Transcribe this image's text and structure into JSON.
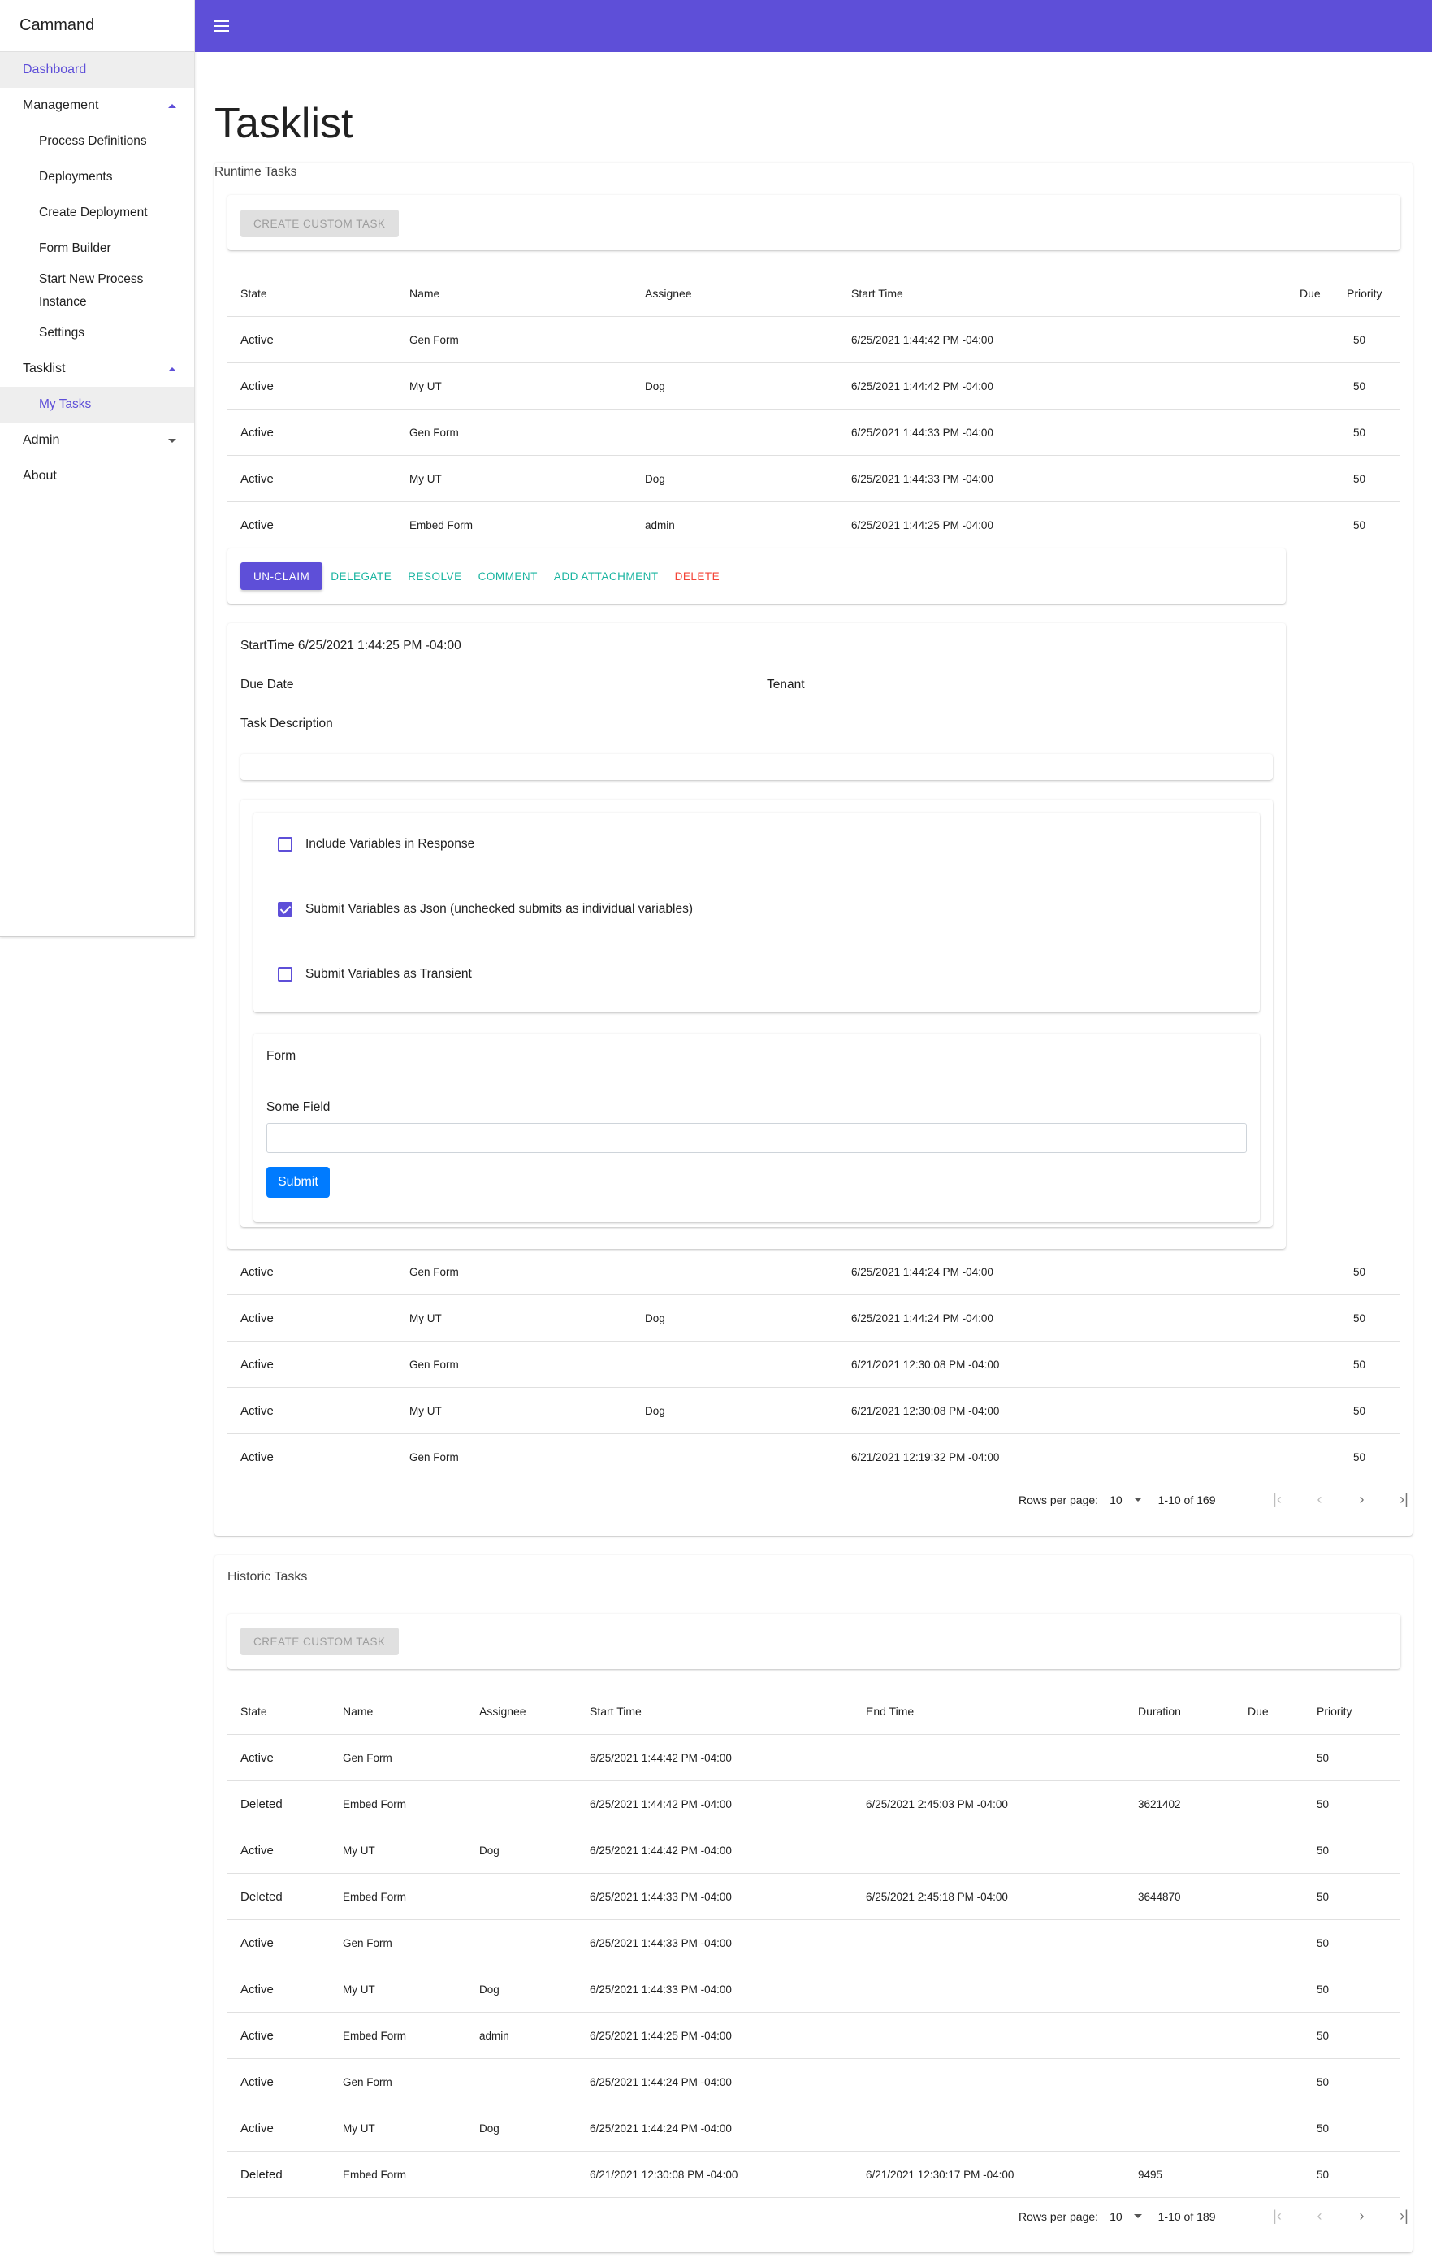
{
  "app": {
    "title": "Cammand",
    "accent_color": "#5e4fd8"
  },
  "sidebar": {
    "dashboard": "Dashboard",
    "management": "Management",
    "management_items": [
      "Process Definitions",
      "Deployments",
      "Create Deployment",
      "Form Builder",
      "Start New Process\nInstance",
      "Settings"
    ],
    "start_new_line1": "Start New Process",
    "start_new_line2": "Instance",
    "tasklist": "Tasklist",
    "my_tasks": "My Tasks",
    "admin": "Admin",
    "about": "About"
  },
  "page": {
    "title": "Tasklist"
  },
  "runtime": {
    "label": "Runtime Tasks",
    "create_button": "CREATE CUSTOM TASK",
    "columns": [
      "State",
      "Name",
      "Assignee",
      "Start Time",
      "Due",
      "Priority"
    ],
    "rows_before": [
      [
        "Active",
        "Gen Form",
        "",
        "6/25/2021 1:44:42 PM -04:00",
        "",
        "50"
      ],
      [
        "Active",
        "My UT",
        "Dog",
        "6/25/2021 1:44:42 PM -04:00",
        "",
        "50"
      ],
      [
        "Active",
        "Gen Form",
        "",
        "6/25/2021 1:44:33 PM -04:00",
        "",
        "50"
      ],
      [
        "Active",
        "My UT",
        "Dog",
        "6/25/2021 1:44:33 PM -04:00",
        "",
        "50"
      ],
      [
        "Active",
        "Embed Form",
        "admin",
        "6/25/2021 1:44:25 PM -04:00",
        "",
        "50"
      ]
    ],
    "actions": {
      "unclaim": "UN-CLAIM",
      "delegate": "DELEGATE",
      "resolve": "RESOLVE",
      "comment": "COMMENT",
      "add_attachment": "ADD ATTACHMENT",
      "delete": "DELETE"
    },
    "detail": {
      "start_time": "StartTime 6/25/2021 1:44:25 PM -04:00",
      "due_date": "Due Date",
      "tenant": "Tenant",
      "task_description": "Task Description",
      "options": [
        {
          "label": "Include Variables in Response",
          "checked": false
        },
        {
          "label": "Submit Variables as Json (unchecked submits as individual variables)",
          "checked": true
        },
        {
          "label": "Submit Variables as Transient",
          "checked": false
        }
      ],
      "form_title": "Form",
      "field_label": "Some Field",
      "field_value": "",
      "submit": "Submit"
    },
    "rows_after": [
      [
        "Active",
        "Gen Form",
        "",
        "6/25/2021 1:44:24 PM -04:00",
        "",
        "50"
      ],
      [
        "Active",
        "My UT",
        "Dog",
        "6/25/2021 1:44:24 PM -04:00",
        "",
        "50"
      ],
      [
        "Active",
        "Gen Form",
        "",
        "6/21/2021 12:30:08 PM -04:00",
        "",
        "50"
      ],
      [
        "Active",
        "My UT",
        "Dog",
        "6/21/2021 12:30:08 PM -04:00",
        "",
        "50"
      ],
      [
        "Active",
        "Gen Form",
        "",
        "6/21/2021 12:19:32 PM -04:00",
        "",
        "50"
      ]
    ],
    "pager": {
      "rows_per_page": "Rows per page:",
      "value": "10",
      "range": "1-10 of 169"
    }
  },
  "historic": {
    "label": "Historic Tasks",
    "create_button": "CREATE CUSTOM TASK",
    "columns": [
      "State",
      "Name",
      "Assignee",
      "Start Time",
      "End Time",
      "Duration",
      "Due",
      "Priority"
    ],
    "rows": [
      [
        "Active",
        "Gen Form",
        "",
        "6/25/2021 1:44:42 PM -04:00",
        "",
        "",
        "",
        "50"
      ],
      [
        "Deleted",
        "Embed Form",
        "",
        "6/25/2021 1:44:42 PM -04:00",
        "6/25/2021 2:45:03 PM -04:00",
        "3621402",
        "",
        "50"
      ],
      [
        "Active",
        "My UT",
        "Dog",
        "6/25/2021 1:44:42 PM -04:00",
        "",
        "",
        "",
        "50"
      ],
      [
        "Deleted",
        "Embed Form",
        "",
        "6/25/2021 1:44:33 PM -04:00",
        "6/25/2021 2:45:18 PM -04:00",
        "3644870",
        "",
        "50"
      ],
      [
        "Active",
        "Gen Form",
        "",
        "6/25/2021 1:44:33 PM -04:00",
        "",
        "",
        "",
        "50"
      ],
      [
        "Active",
        "My UT",
        "Dog",
        "6/25/2021 1:44:33 PM -04:00",
        "",
        "",
        "",
        "50"
      ],
      [
        "Active",
        "Embed Form",
        "admin",
        "6/25/2021 1:44:25 PM -04:00",
        "",
        "",
        "",
        "50"
      ],
      [
        "Active",
        "Gen Form",
        "",
        "6/25/2021 1:44:24 PM -04:00",
        "",
        "",
        "",
        "50"
      ],
      [
        "Active",
        "My UT",
        "Dog",
        "6/25/2021 1:44:24 PM -04:00",
        "",
        "",
        "",
        "50"
      ],
      [
        "Deleted",
        "Embed Form",
        "",
        "6/21/2021 12:30:08 PM -04:00",
        "6/21/2021 12:30:17 PM -04:00",
        "9495",
        "",
        "50"
      ]
    ],
    "pager": {
      "rows_per_page": "Rows per page:",
      "value": "10",
      "range": "1-10 of 189"
    }
  }
}
